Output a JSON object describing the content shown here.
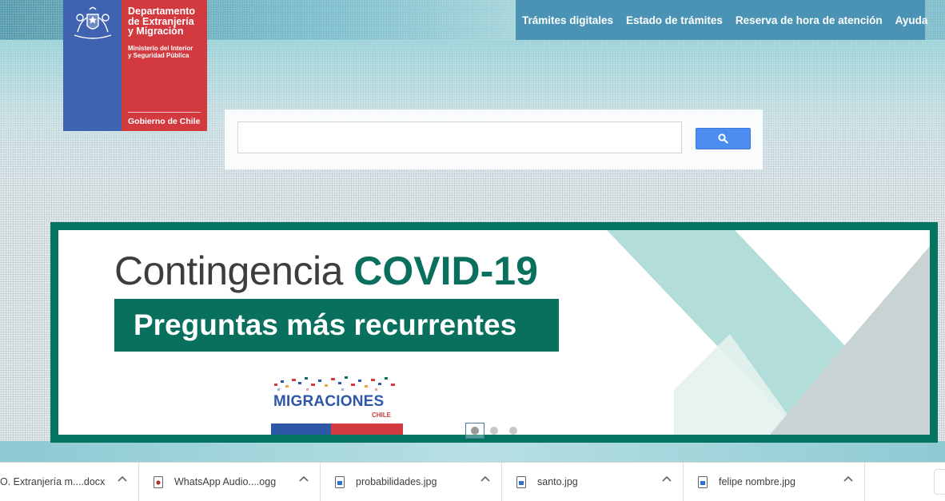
{
  "logo": {
    "line1": "Departamento",
    "line2": "de Extranjería",
    "line3": "y Migración",
    "ministry1": "Ministerio del Interior",
    "ministry2": "y Seguridad Pública",
    "government": "Gobierno de Chile"
  },
  "nav": {
    "items": [
      {
        "label": "Trámites digitales"
      },
      {
        "label": "Estado de trámites"
      },
      {
        "label": "Reserva de hora de atención"
      },
      {
        "label": "Ayuda"
      }
    ]
  },
  "search": {
    "value": "",
    "button_icon": "search-icon"
  },
  "banner": {
    "title_plain": "Contingencia ",
    "title_bold": "COVID-19",
    "subtitle": "Preguntas más recurrentes",
    "brand": "MIGRACIONES",
    "brand_country": "CHILE",
    "colors": {
      "green": "#08705c",
      "blue": "#2e57a8",
      "red": "#d23a3f"
    }
  },
  "carousel": {
    "active_index": 0,
    "count": 3
  },
  "downloads": [
    {
      "name": "O. Extranjería m....docx",
      "icon": "word-file-icon"
    },
    {
      "name": "WhatsApp Audio....ogg",
      "icon": "audio-file-icon"
    },
    {
      "name": "probabilidades.jpg",
      "icon": "image-file-icon"
    },
    {
      "name": "santo.jpg",
      "icon": "image-file-icon"
    },
    {
      "name": "felipe nombre.jpg",
      "icon": "image-file-icon"
    }
  ]
}
